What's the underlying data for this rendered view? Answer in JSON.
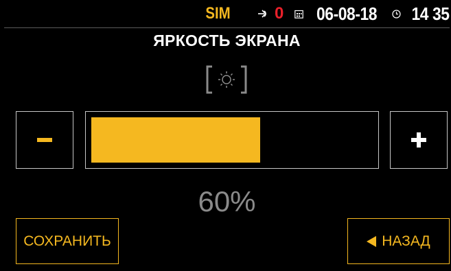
{
  "status": {
    "sim_label": "SIM",
    "sms_icon": "sms-icon",
    "sms_count": "0",
    "calendar_icon": "calendar-icon",
    "date": "06-08-18",
    "clock_icon": "clock-icon",
    "time": "14 35"
  },
  "screen": {
    "title": "ЯРКОСТЬ ЭКРАНА",
    "brightness_icon": "brightness-icon",
    "brightness_value": 60,
    "brightness_text": "60%"
  },
  "buttons": {
    "decrease_icon": "minus-icon",
    "increase_icon": "plus-icon",
    "save_label": "СОХРАНИТЬ",
    "back_label": "НАЗАД"
  },
  "colors": {
    "accent": "#f5b820",
    "alert": "#e8202a",
    "muted": "#8a8a8a",
    "border": "#c8c8c8"
  }
}
